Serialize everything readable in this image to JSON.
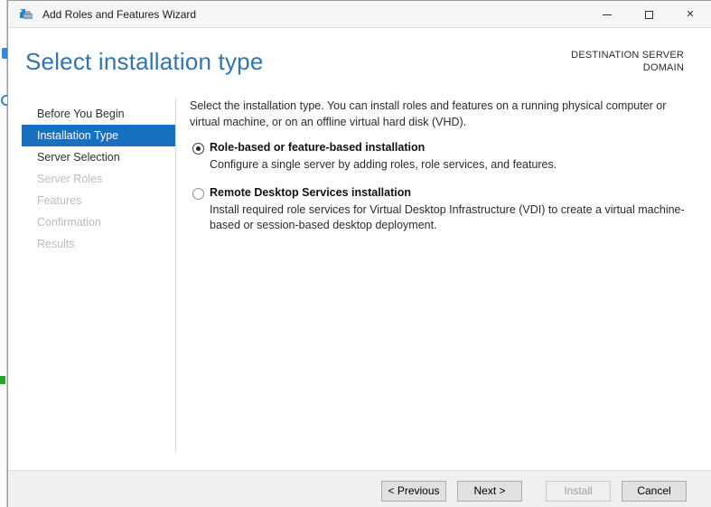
{
  "window": {
    "title": "Add Roles and Features Wizard",
    "icons": {
      "app": "server-manager-toolbox",
      "minimize": "minimize-line",
      "maximize": "maximize-square",
      "close": "✕"
    }
  },
  "header": {
    "title": "Select installation type",
    "destination_label": "DESTINATION SERVER",
    "destination_value": "DOMAIN"
  },
  "sidebar": {
    "items": [
      {
        "label": "Before You Begin",
        "state": "enabled"
      },
      {
        "label": "Installation Type",
        "state": "selected"
      },
      {
        "label": "Server Selection",
        "state": "enabled"
      },
      {
        "label": "Server Roles",
        "state": "disabled"
      },
      {
        "label": "Features",
        "state": "disabled"
      },
      {
        "label": "Confirmation",
        "state": "disabled"
      },
      {
        "label": "Results",
        "state": "disabled"
      }
    ]
  },
  "content": {
    "description": "Select the installation type. You can install roles and features on a running physical computer or virtual machine, or on an offline virtual hard disk (VHD).",
    "options": [
      {
        "label": "Role-based or feature-based installation",
        "description": "Configure a single server by adding roles, role services, and features.",
        "selected": true
      },
      {
        "label": "Remote Desktop Services installation",
        "description": "Install required role services for Virtual Desktop Infrastructure (VDI) to create a virtual machine-based or session-based desktop deployment.",
        "selected": false
      }
    ]
  },
  "footer": {
    "buttons": [
      {
        "label": "< Previous",
        "enabled": true
      },
      {
        "label": "Next >",
        "enabled": true
      },
      {
        "label": "Install",
        "enabled": false
      },
      {
        "label": "Cancel",
        "enabled": true
      }
    ]
  },
  "colors": {
    "accent_selected": "#1a70c0",
    "heading_blue": "#3474ab",
    "footer_bg": "#f0f0f0",
    "button_bg": "#e1e1e1",
    "button_border": "#acacac",
    "disabled_text": "#bcbcbc"
  }
}
